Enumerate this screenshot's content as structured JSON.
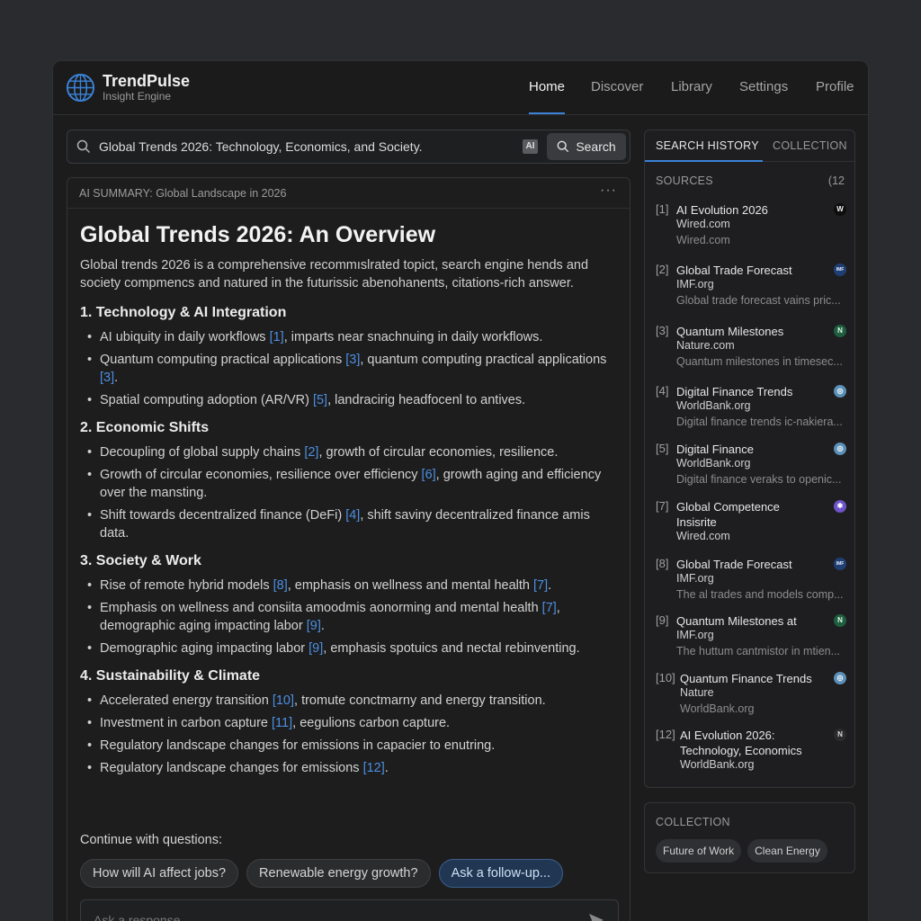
{
  "app": {
    "name": "TrendPulse",
    "tagline": "Insight Engine",
    "accent": "#3b82d6"
  },
  "nav": [
    "Home",
    "Discover",
    "Library",
    "Settings",
    "Profile"
  ],
  "search": {
    "query": "Global Trends 2026: Technology, Economics, and Society.",
    "ai_badge": "AI",
    "button": "Search"
  },
  "summary": {
    "header": "AI SUMMARY: Global Landscape in 2026",
    "more": "···",
    "title": "Global Trends 2026: An Overview",
    "intro": "Global trends 2026 is a comprehensive recommıslrated topict, search engine hends and society compmencs and natured in the futurissic abenohanents, citations-rich answer.",
    "sections": [
      {
        "heading": "1. Technology & AI Integration",
        "bullets": [
          {
            "pre": "AI ubiquity in daily workflows ",
            "cite": "[1]",
            "post": ", imparts near snachnuing in daily workflows.",
            "cite2": "",
            "post2": ""
          },
          {
            "pre": "Quantum computing practical applications ",
            "cite": "[3]",
            "post": ", quantum computing practical applications ",
            "cite2": "[3]",
            "post2": "."
          },
          {
            "pre": "Spatial computing adoption (AR/VR) ",
            "cite": "[5]",
            "post": ", landracirig headfocenl to antives.",
            "cite2": "",
            "post2": ""
          }
        ]
      },
      {
        "heading": "2. Economic Shifts",
        "bullets": [
          {
            "pre": "Decoupling of global supply chains ",
            "cite": "[2]",
            "post": ", growth of circular economies, resilience.",
            "cite2": "",
            "post2": ""
          },
          {
            "pre": "Growth of circular economies, resilience over efficiency ",
            "cite": "[6]",
            "post": ", growth aging and efficiency over the mansting.",
            "cite2": "",
            "post2": ""
          },
          {
            "pre": "Shift towards decentralized finance (DeFi) ",
            "cite": "[4]",
            "post": ", shift saviny decentralized finance amis data.",
            "cite2": "",
            "post2": ""
          }
        ]
      },
      {
        "heading": "3. Society & Work",
        "bullets": [
          {
            "pre": "Rise of remote hybrid models ",
            "cite": "[8]",
            "post": ", emphasis on wellness and mental health ",
            "cite2": "[7]",
            "post2": "."
          },
          {
            "pre": "Emphasis on wellness and consiita amoodmis aonorming and mental health ",
            "cite": "[7]",
            "post": ", demographic aging impacting labor ",
            "cite2": "[9]",
            "post2": "."
          },
          {
            "pre": "Demographic aging impacting labor ",
            "cite": "[9]",
            "post": ", emphasis spotuics and nectal rebinventing.",
            "cite2": "",
            "post2": ""
          }
        ]
      },
      {
        "heading": "4. Sustainability & Climate",
        "bullets": [
          {
            "pre": "Accelerated energy transition ",
            "cite": "[10]",
            "post": ", tromute conctmarny and energy transition.",
            "cite2": "",
            "post2": ""
          },
          {
            "pre": "Investment in carbon capture ",
            "cite": "[11]",
            "post": ", eegulions carbon capture.",
            "cite2": "",
            "post2": ""
          },
          {
            "pre": "Regulatory landscape changes for emissions in capacier to enutring.",
            "cite": "",
            "post": "",
            "cite2": "",
            "post2": ""
          },
          {
            "pre": "Regulatory landscape changes for emissions ",
            "cite": "[12]",
            "post": ".",
            "cite2": "",
            "post2": ""
          }
        ]
      }
    ],
    "continue_label": "Continue with questions:",
    "suggestions": [
      "How will AI affect jobs?",
      "Renewable energy growth?",
      "Ask a follow-up..."
    ],
    "reply_placeholder": "Ask a response..."
  },
  "sidebar": {
    "tabs": [
      "SEARCH HISTORY",
      "COLLECTION"
    ],
    "sources_label": "SOURCES",
    "sources_count": "(12",
    "sources": [
      {
        "num": "[1]",
        "title": "AI Evolution 2026",
        "site": "Wired.com",
        "snippet": "Wired.com",
        "icon": "W",
        "icon_name": "wired-icon",
        "icon_bg": "#0e0e0e",
        "icon_fg": "#f0f0f0"
      },
      {
        "num": "[2]",
        "title": "Global Trade Forecast",
        "site": "IMF.org",
        "snippet": "Global trade forecast vains pric...",
        "icon": "IMF",
        "icon_name": "imf-icon",
        "icon_bg": "#1f3f74",
        "icon_fg": "#e8eefa"
      },
      {
        "num": "[3]",
        "title": "Quantum Milestones",
        "site": "Nature.com",
        "snippet": "Quantum milestones in timesec...",
        "icon": "N",
        "icon_name": "nature-icon",
        "icon_bg": "#1f5e3f",
        "icon_fg": "#dff5e8"
      },
      {
        "num": "[4]",
        "title": "Digital Finance Trends",
        "site": "WorldBank.org",
        "snippet": "Digital finance trends ic-nakiera...",
        "icon": "◎",
        "icon_name": "worldbank-icon",
        "icon_bg": "#5a8fb8",
        "icon_fg": "#ffffff"
      },
      {
        "num": "[5]",
        "title": "Digital Finance",
        "site": "WorldBank.org",
        "snippet": "Digital finance veraks to openic...",
        "icon": "◎",
        "icon_name": "worldbank-icon",
        "icon_bg": "#5a8fb8",
        "icon_fg": "#ffffff"
      },
      {
        "num": "[7]",
        "title": "Global Competence Insisrite",
        "site": "Wired.com",
        "snippet": "",
        "icon": "✱",
        "icon_name": "sparkle-icon",
        "icon_bg": "#6f54c9",
        "icon_fg": "#ffffff"
      },
      {
        "num": "[8]",
        "title": "Global Trade Forecast",
        "site": "IMF.org",
        "snippet": "The al trades and models comp...",
        "icon": "IMF",
        "icon_name": "imf-icon",
        "icon_bg": "#1f3f74",
        "icon_fg": "#e8eefa"
      },
      {
        "num": "[9]",
        "title": "Quantum Milestones at",
        "site": "IMF.org",
        "snippet": "The huttum cantmistor in mtien...",
        "icon": "N",
        "icon_name": "nature-icon",
        "icon_bg": "#1f5e3f",
        "icon_fg": "#dff5e8"
      },
      {
        "num": "[10]",
        "title": "Quantum Finance Trends",
        "site": "Nature",
        "snippet": "WorldBank.org",
        "icon": "◎",
        "icon_name": "worldbank-icon",
        "icon_bg": "#5a8fb8",
        "icon_fg": "#ffffff"
      },
      {
        "num": "[12]",
        "title": "AI Evolution 2026: Technology, Economics",
        "site": "WorldBank.org",
        "snippet": "",
        "icon": "N",
        "icon_name": "n-logo-icon",
        "icon_bg": "#2b2b2d",
        "icon_fg": "#d8d8d8"
      }
    ]
  },
  "collection": {
    "label": "COLLECTION",
    "tags": [
      "Future of Work",
      "Clean Energy"
    ]
  }
}
